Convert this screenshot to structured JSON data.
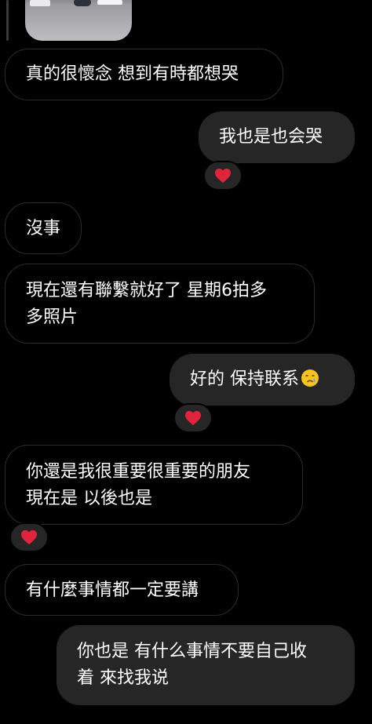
{
  "theme": {
    "background": "#000000",
    "bubble_color": "#262626",
    "incoming_border": "#2c2c2c",
    "heart_color": "#e0243b"
  },
  "messages": [
    {
      "id": "m1",
      "side": "incoming",
      "lines": [
        "真的很懷念 想到有時都想哭"
      ]
    },
    {
      "id": "m2",
      "side": "outgoing",
      "lines": [
        "我也是也会哭"
      ],
      "reaction": "heart"
    },
    {
      "id": "m3",
      "side": "incoming",
      "lines": [
        "沒事"
      ]
    },
    {
      "id": "m4",
      "side": "incoming",
      "lines": [
        "現在還有聯繫就好了 星期6拍多",
        "多照片"
      ]
    },
    {
      "id": "m5",
      "side": "outgoing",
      "lines": [
        "好的 保持联系"
      ],
      "emoji": "crying-face",
      "reaction": "heart"
    },
    {
      "id": "m6",
      "side": "incoming",
      "lines": [
        "你還是我很重要很重要的朋友",
        "現在是 以後也是"
      ],
      "reaction": "heart"
    },
    {
      "id": "m7",
      "side": "incoming",
      "lines": [
        "有什麼事情都一定要講"
      ]
    },
    {
      "id": "m8",
      "side": "outgoing",
      "lines": [
        "你也是 有什么事情不要自己收",
        "着 來找我说"
      ]
    }
  ]
}
